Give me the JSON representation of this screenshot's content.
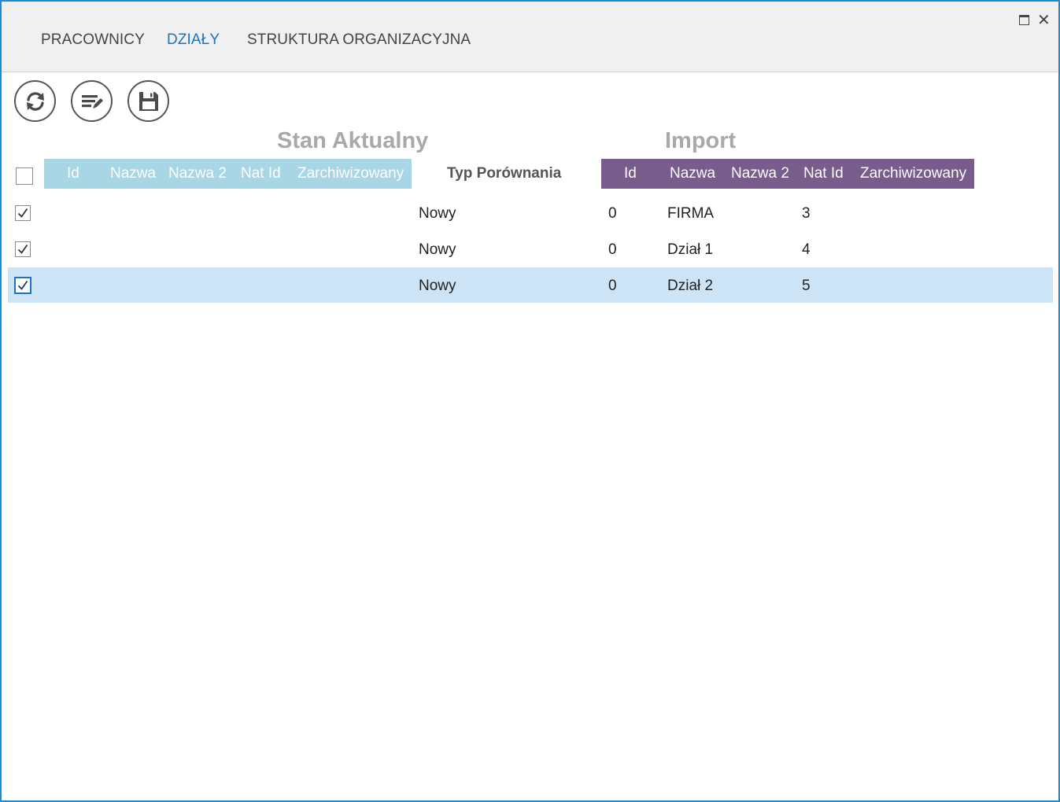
{
  "tabs": [
    {
      "label": "PRACOWNICY",
      "active": false
    },
    {
      "label": "DZIAŁY",
      "active": true
    },
    {
      "label": "STRUKTURA ORGANIZACYJNA",
      "active": false
    }
  ],
  "toolbar": {
    "refresh_icon": "refresh-icon",
    "edit_icon": "edit-list-icon",
    "save_icon": "save-icon"
  },
  "sections": {
    "current_title": "Stan Aktualny",
    "import_title": "Import"
  },
  "columns": {
    "current": [
      "Id",
      "Nazwa",
      "Nazwa 2",
      "Nat Id",
      "Zarchiwizowany"
    ],
    "compare": "Typ Porównania",
    "import": [
      "Id",
      "Nazwa",
      "Nazwa 2",
      "Nat Id",
      "Zarchiwizowany"
    ]
  },
  "header_checkbox_checked": false,
  "rows": [
    {
      "checked": true,
      "current": [
        "",
        "",
        "",
        "",
        ""
      ],
      "compare": "Nowy",
      "import": [
        "0",
        "FIRMA",
        "",
        "3",
        ""
      ],
      "selected": false
    },
    {
      "checked": true,
      "current": [
        "",
        "",
        "",
        "",
        ""
      ],
      "compare": "Nowy",
      "import": [
        "0",
        "Dział 1",
        "",
        "4",
        ""
      ],
      "selected": false
    },
    {
      "checked": true,
      "current": [
        "",
        "",
        "",
        "",
        ""
      ],
      "compare": "Nowy",
      "import": [
        "0",
        "Dział 2",
        "",
        "5",
        ""
      ],
      "selected": true
    }
  ],
  "colors": {
    "window_border": "#1f8ad6",
    "active_tab": "#1e73be",
    "current_header_bg": "#a9d6e4",
    "import_header_bg": "#775c8c",
    "selected_row_bg": "#cde4f6"
  }
}
